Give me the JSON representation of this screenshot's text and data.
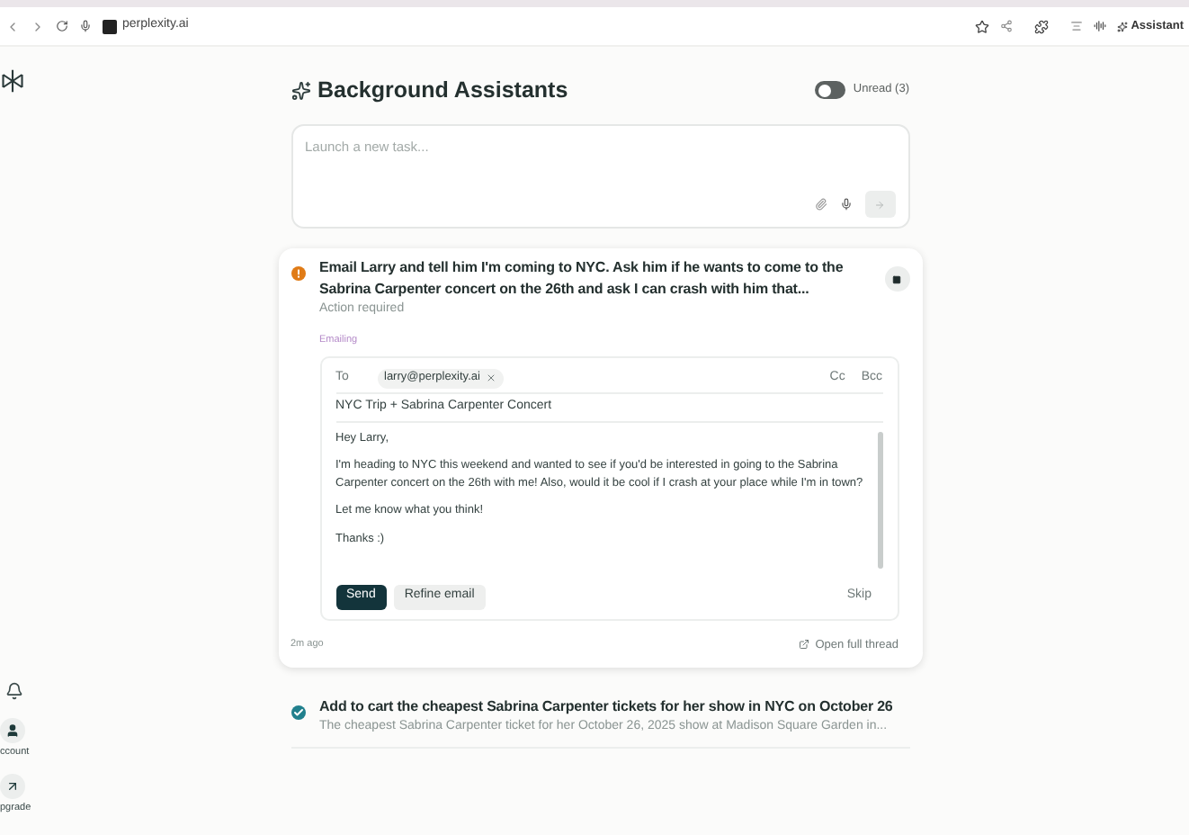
{
  "browser": {
    "url": "perplexity.ai",
    "assistant": "Assistant"
  },
  "sidebar": {
    "items": [
      {
        "kind": "bell"
      },
      {
        "kind": "account",
        "label": "ccount"
      },
      {
        "kind": "upgrade",
        "label": "pgrade"
      }
    ]
  },
  "header": {
    "title": "Background Assistants",
    "unread_toggle": {
      "label": "Unread (3)",
      "on": false
    }
  },
  "composer": {
    "placeholder": "Launch a new task..."
  },
  "tasks": [
    {
      "kind": "action",
      "title": "Email Larry and tell him I'm coming to NYC. Ask him if he wants to come to the Sabrina Carpenter concert on the 26th and ask I can crash with him that...",
      "status": "Action required",
      "expanded": true,
      "email": {
        "section": "Emailing",
        "to_label": "To",
        "recipient": "larry@perplexity.ai",
        "cc": "Cc",
        "bcc": "Bcc",
        "subject": "NYC Trip + Sabrina Carpenter Concert",
        "body": [
          "Hey Larry,",
          "I'm heading to NYC this weekend and wanted to see if you'd be interested in going to the Sabrina Carpenter concert on the 26th with me! Also, would it be cool if I crash at your place while I'm in town?",
          "Let me know what you think!",
          "Thanks :)"
        ],
        "send": "Send",
        "refine": "Refine email",
        "skip": "Skip"
      },
      "time": "2m ago",
      "open_thread": "Open full thread"
    },
    {
      "kind": "done",
      "title": "Add to cart the cheapest Sabrina Carpenter tickets for her show in NYC on October 26",
      "status": "The cheapest Sabrina Carpenter ticket for her October 26, 2025 show at Madison Square Garden in...",
      "expanded": false
    }
  ]
}
